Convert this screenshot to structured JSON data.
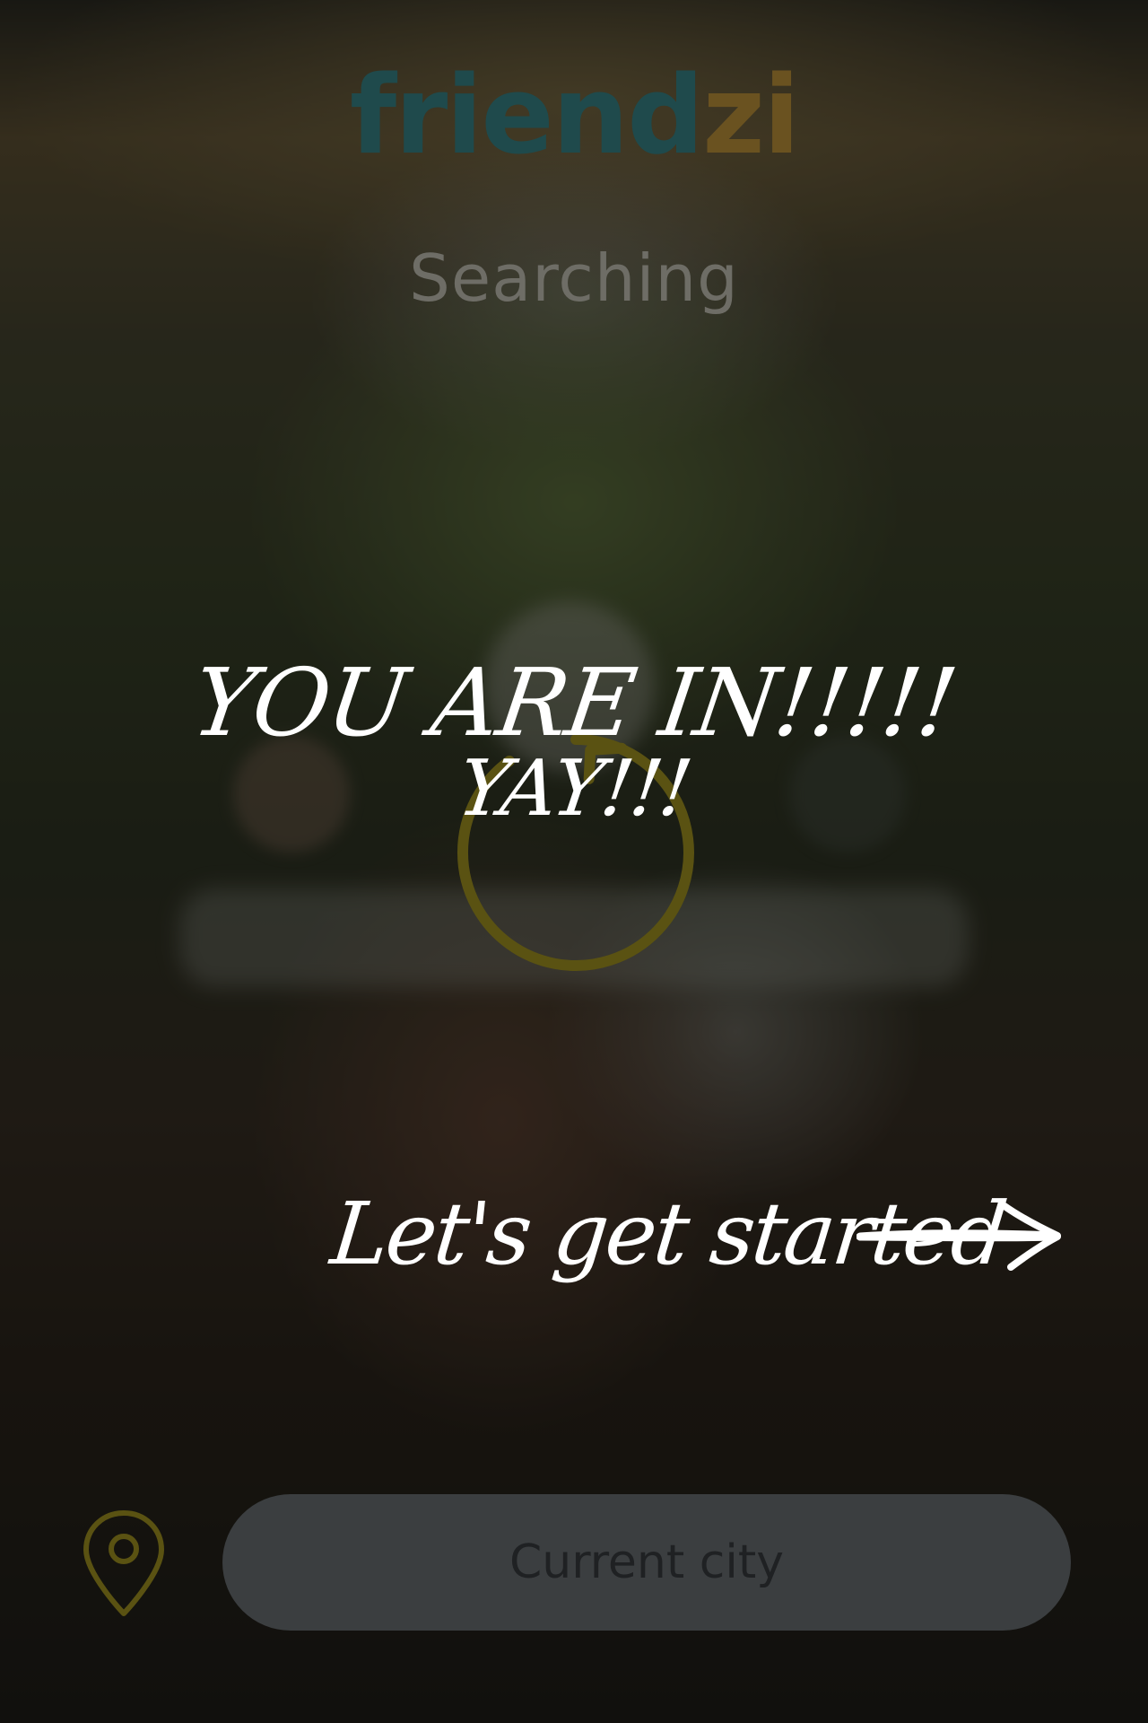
{
  "app": {
    "logo_part1": "friend",
    "logo_part2": "zi",
    "logo_color1": "#1f4a4c",
    "logo_color2": "#6a5220"
  },
  "status": {
    "text": "Searching"
  },
  "spinner": {
    "icon": "loading-spinner-icon",
    "color": "#5a5212"
  },
  "celebration": {
    "line1": "YOU ARE IN!!!!!",
    "line2": "YAY!!!"
  },
  "cta": {
    "label": "Let's get started",
    "icon": "arrow-right-icon"
  },
  "location": {
    "icon": "map-pin-icon",
    "icon_color": "#5a5212",
    "placeholder": "Current city",
    "value": ""
  }
}
